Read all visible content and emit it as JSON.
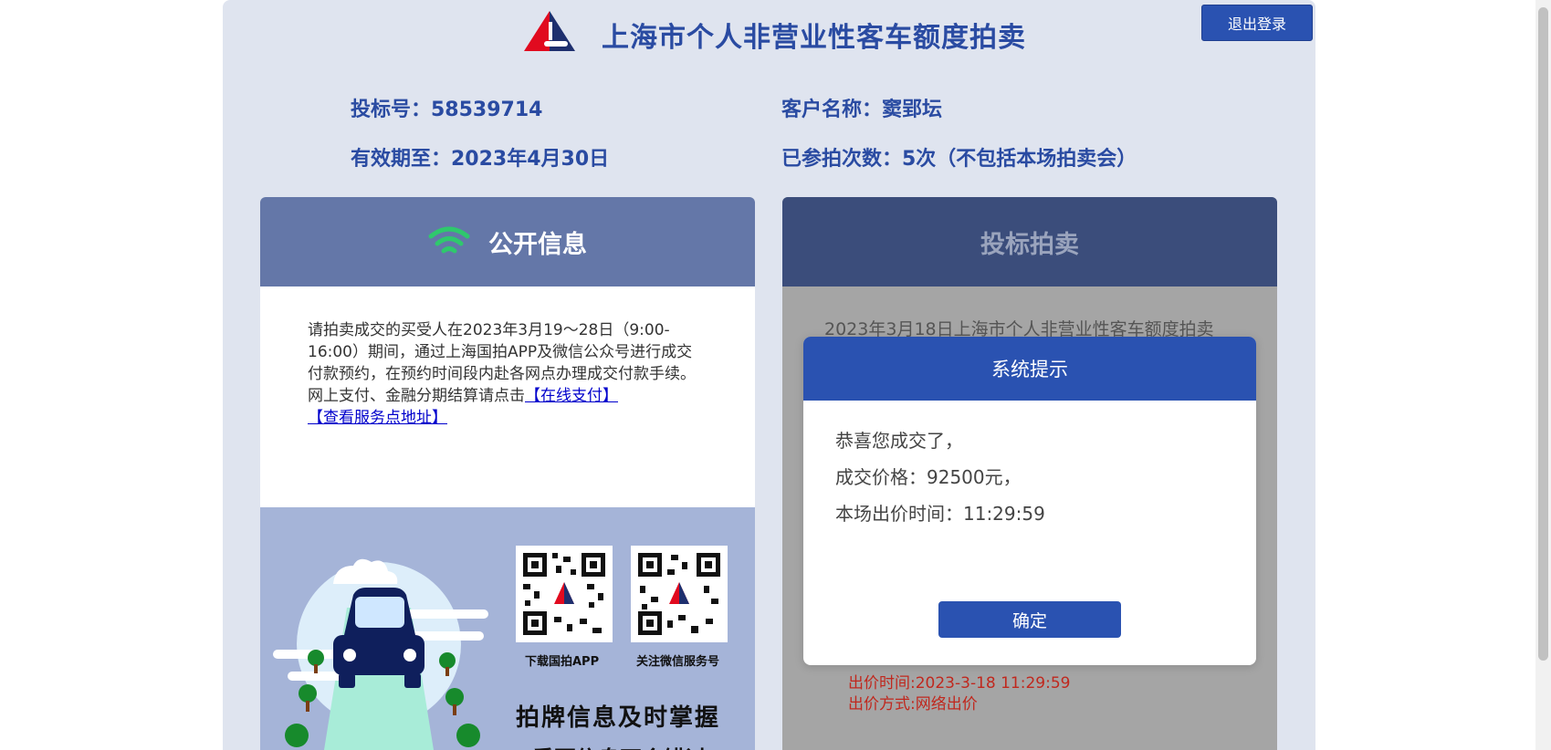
{
  "header": {
    "title": "上海市个人非营业性客车额度拍卖",
    "logout_label": "退出登录"
  },
  "bidder_info": {
    "bid_number": "投标号：58539714",
    "customer_name": "客户名称：窦郢坛",
    "valid_until": "有效期至：2023年4月30日",
    "participation_count": "已参拍次数：5次（不包括本场拍卖会）"
  },
  "public_info": {
    "title": "公开信息",
    "notice": "请拍卖成交的买受人在2023年3月19～28日（9:00-16:00）期间，通过上海国拍APP及微信公众号进行成交付款预约，在预约时间段内赴各网点办理成交付款手续。",
    "payment_prefix": "网上支付、金融分期结算请点击",
    "online_pay_link": "【在线支付】",
    "service_point_link": "【查看服务点地址】"
  },
  "promo": {
    "qr_app_caption": "下载国拍APP",
    "qr_wechat_caption": "关注微信服务号",
    "slogan": "拍牌信息及时掌握",
    "slogan_sub": "重要信息不会错过"
  },
  "bidding": {
    "title": "投标拍卖",
    "auction_text": "2023年3月18日上海市个人非营业性客车额度拍卖",
    "bid_time": "出价时间:2023-3-18 11:29:59",
    "bid_method": "出价方式:网络出价"
  },
  "modal": {
    "title": "系统提示",
    "line1": "恭喜您成交了，",
    "line2": "成交价格：92500元，",
    "line3": "本场出价时间：11:29:59",
    "ok_label": "确定"
  },
  "colors": {
    "brand_blue": "#2a52b1",
    "title_blue": "#2a4ba2",
    "page_bg": "#dfe4ef",
    "public_header": "#6477a8",
    "bidding_header": "#3b4d7b",
    "bid_red": "#c0281e",
    "wifi_green": "#2fc86d"
  }
}
